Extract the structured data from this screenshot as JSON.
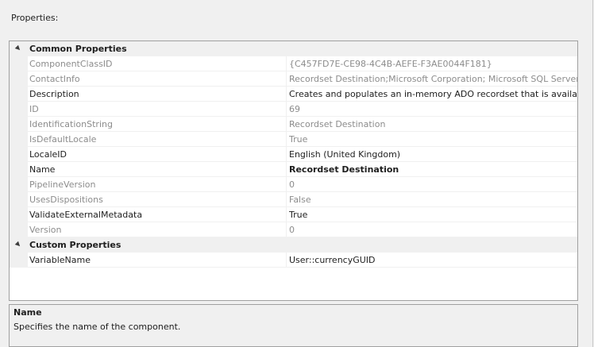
{
  "panel": {
    "title": "Properties:"
  },
  "categories": [
    {
      "label": "Common Properties",
      "rows": [
        {
          "name": "ComponentClassID",
          "value": "{C457FD7E-CE98-4C4B-AEFE-F3AE0044F181}",
          "readonly": true,
          "bold": false
        },
        {
          "name": "ContactInfo",
          "value": "Recordset Destination;Microsoft Corporation; Microsoft SQL Server; (",
          "readonly": true,
          "bold": false
        },
        {
          "name": "Description",
          "value": "Creates and populates an in-memory ADO recordset that is available",
          "readonly": false,
          "bold": false
        },
        {
          "name": "ID",
          "value": "69",
          "readonly": true,
          "bold": false
        },
        {
          "name": "IdentificationString",
          "value": "Recordset Destination",
          "readonly": true,
          "bold": false
        },
        {
          "name": "IsDefaultLocale",
          "value": "True",
          "readonly": true,
          "bold": false
        },
        {
          "name": "LocaleID",
          "value": "English (United Kingdom)",
          "readonly": false,
          "bold": false
        },
        {
          "name": "Name",
          "value": "Recordset Destination",
          "readonly": false,
          "bold": true
        },
        {
          "name": "PipelineVersion",
          "value": "0",
          "readonly": true,
          "bold": false
        },
        {
          "name": "UsesDispositions",
          "value": "False",
          "readonly": true,
          "bold": false
        },
        {
          "name": "ValidateExternalMetadata",
          "value": "True",
          "readonly": false,
          "bold": false
        },
        {
          "name": "Version",
          "value": "0",
          "readonly": true,
          "bold": false
        }
      ]
    },
    {
      "label": "Custom Properties",
      "rows": [
        {
          "name": "VariableName",
          "value": "User::currencyGUID",
          "readonly": false,
          "bold": false
        }
      ]
    }
  ],
  "help": {
    "title": "Name",
    "description": "Specifies the name of the component."
  }
}
